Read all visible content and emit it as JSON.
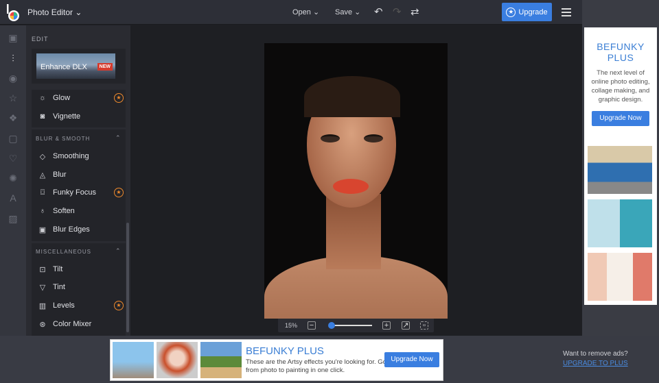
{
  "header": {
    "app_title": "Photo Editor",
    "open": "Open",
    "save": "Save",
    "upgrade": "Upgrade"
  },
  "panel": {
    "edit_label": "EDIT",
    "enhance": "Enhance DLX",
    "new_badge": "NEW",
    "top_items": [
      {
        "label": "Glow",
        "pro": true
      },
      {
        "label": "Vignette",
        "pro": false
      }
    ],
    "sections": [
      {
        "title": "BLUR & SMOOTH",
        "items": [
          {
            "label": "Smoothing"
          },
          {
            "label": "Blur"
          },
          {
            "label": "Funky Focus",
            "pro": true
          },
          {
            "label": "Soften"
          },
          {
            "label": "Blur Edges"
          }
        ]
      },
      {
        "title": "MISCELLANEOUS",
        "items": [
          {
            "label": "Tilt"
          },
          {
            "label": "Tint"
          },
          {
            "label": "Levels",
            "pro": true
          },
          {
            "label": "Color Mixer"
          }
        ]
      }
    ]
  },
  "zoom": {
    "level": "15%",
    "slider_fraction": 0.05
  },
  "side_ad": {
    "title": "BEFUNKY PLUS",
    "text": "The next level of online photo editing, collage making, and graphic design.",
    "button": "Upgrade Now"
  },
  "bottom_ad": {
    "title": "BEFUNKY PLUS",
    "text": "These are the Artsy effects you're looking for. Go from photo to painting in one click.",
    "button": "Upgrade Now"
  },
  "remove_ads": {
    "text": "Want to remove ads?",
    "link": "UPGRADE TO PLUS"
  },
  "colors": {
    "accent": "#3a7ee0",
    "pro": "#f08a2c"
  }
}
